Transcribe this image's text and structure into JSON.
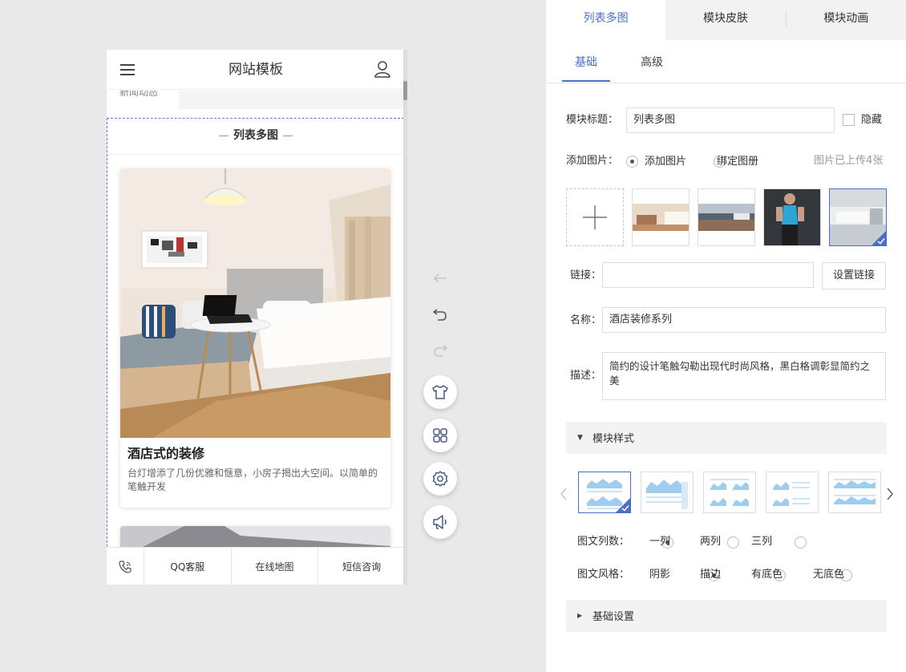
{
  "phone": {
    "header_title": "网站模板",
    "strip_tab_label": "新闻动态",
    "module_title": "列表多图",
    "card": {
      "title": "酒店式的装修",
      "desc": "台灯增添了几份优雅和惬意，小房子揭出大空间。以简单的笔触开发"
    },
    "footer": [
      "QQ客服",
      "在线地图",
      "短信咨询"
    ]
  },
  "panel": {
    "top_tabs": [
      "列表多图",
      "模块皮肤",
      "模块动画"
    ],
    "sub_tabs": [
      "基础",
      "高级"
    ],
    "module_title_label": "模块标题：",
    "module_title_value": "列表多图",
    "hide_label": "隐藏",
    "add_image_label": "添加图片：",
    "add_image_opt1": "添加图片",
    "add_image_opt2": "绑定图册",
    "uploaded_info": "图片已上传4张",
    "link_label": "链接：",
    "link_value": "",
    "set_link_btn": "设置链接",
    "name_label": "名称：",
    "name_value": "酒店装修系列",
    "desc_label": "描述：",
    "desc_value": "简约的设计笔触勾勒出现代时尚风格，黑白格调彰显简约之美",
    "module_style_label": "模块样式",
    "columns_label": "图文列数：",
    "columns_options": [
      "一列",
      "两列",
      "三列"
    ],
    "columns_selected": 0,
    "style_label": "图文风格：",
    "style_options": [
      "阴影",
      "描边",
      "有底色",
      "无底色"
    ],
    "style_selected": 0,
    "basic_settings_label": "基础设置"
  },
  "colors": {
    "accent": "#4a6fc6",
    "background": "#e9e9e9",
    "panel_tab_bg": "#f2f2f2",
    "section_bg": "#f3f3f3",
    "module_border": "#5a7bd8"
  }
}
